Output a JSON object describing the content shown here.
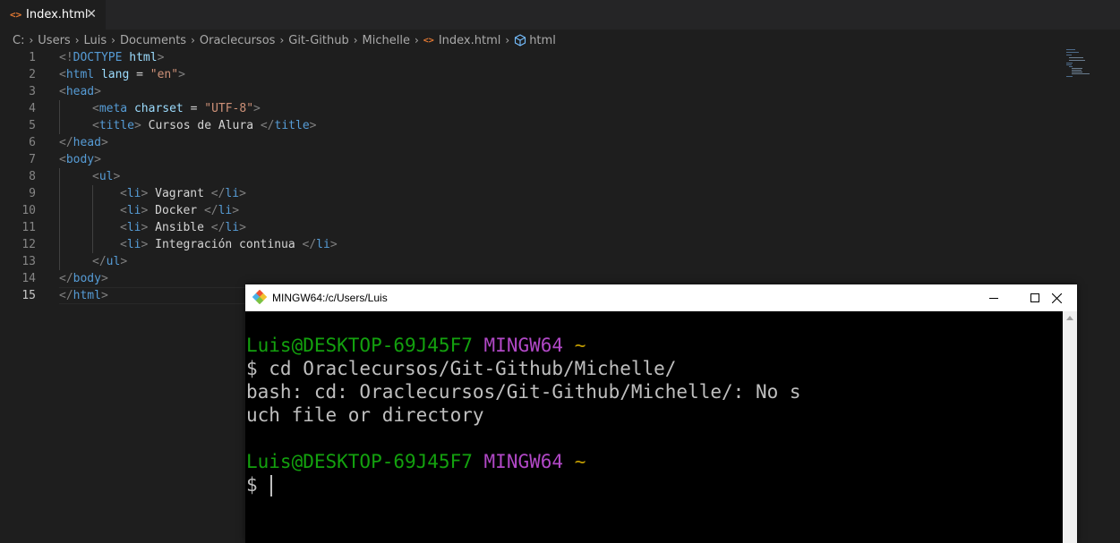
{
  "editor": {
    "tab": {
      "icon": "html-file-icon",
      "label": "Index.html",
      "close_glyph": "✕"
    },
    "breadcrumb": [
      "C:",
      "Users",
      "Luis",
      "Documents",
      "Oraclecursos",
      "Git-Github",
      "Michelle",
      "Index.html",
      "html"
    ],
    "active_line": 15,
    "lines": [
      {
        "n": "1",
        "indent": 0,
        "tokens": [
          [
            "p",
            "<!"
          ],
          [
            "tag",
            "DOCTYPE"
          ],
          [
            "txt",
            " "
          ],
          [
            "attr",
            "html"
          ],
          [
            "p",
            ">"
          ]
        ]
      },
      {
        "n": "2",
        "indent": 0,
        "tokens": [
          [
            "p",
            "<"
          ],
          [
            "tag",
            "html"
          ],
          [
            "txt",
            " "
          ],
          [
            "attr",
            "lang"
          ],
          [
            "txt",
            " = "
          ],
          [
            "str",
            "\"en\""
          ],
          [
            "p",
            ">"
          ]
        ]
      },
      {
        "n": "3",
        "indent": 0,
        "tokens": [
          [
            "p",
            "<"
          ],
          [
            "tag",
            "head"
          ],
          [
            "p",
            ">"
          ]
        ]
      },
      {
        "n": "4",
        "indent": 1,
        "tokens": [
          [
            "p",
            "<"
          ],
          [
            "tag",
            "meta"
          ],
          [
            "txt",
            " "
          ],
          [
            "attr",
            "charset"
          ],
          [
            "txt",
            " = "
          ],
          [
            "str",
            "\"UTF-8\""
          ],
          [
            "p",
            ">"
          ]
        ]
      },
      {
        "n": "5",
        "indent": 1,
        "tokens": [
          [
            "p",
            "<"
          ],
          [
            "tag",
            "title"
          ],
          [
            "p",
            ">"
          ],
          [
            "txt",
            " Cursos de Alura "
          ],
          [
            "p",
            "</"
          ],
          [
            "tag",
            "title"
          ],
          [
            "p",
            ">"
          ]
        ]
      },
      {
        "n": "6",
        "indent": 0,
        "tokens": [
          [
            "p",
            "</"
          ],
          [
            "tag",
            "head"
          ],
          [
            "p",
            ">"
          ]
        ]
      },
      {
        "n": "7",
        "indent": 0,
        "tokens": [
          [
            "p",
            "<"
          ],
          [
            "tag",
            "body"
          ],
          [
            "p",
            ">"
          ]
        ]
      },
      {
        "n": "8",
        "indent": 1,
        "tokens": [
          [
            "p",
            "<"
          ],
          [
            "tag",
            "ul"
          ],
          [
            "p",
            ">"
          ]
        ]
      },
      {
        "n": "9",
        "indent": 2,
        "tokens": [
          [
            "p",
            "<"
          ],
          [
            "tag",
            "li"
          ],
          [
            "p",
            ">"
          ],
          [
            "txt",
            " Vagrant "
          ],
          [
            "p",
            "</"
          ],
          [
            "tag",
            "li"
          ],
          [
            "p",
            ">"
          ]
        ]
      },
      {
        "n": "10",
        "indent": 2,
        "tokens": [
          [
            "p",
            "<"
          ],
          [
            "tag",
            "li"
          ],
          [
            "p",
            ">"
          ],
          [
            "txt",
            " Docker "
          ],
          [
            "p",
            "</"
          ],
          [
            "tag",
            "li"
          ],
          [
            "p",
            ">"
          ]
        ]
      },
      {
        "n": "11",
        "indent": 2,
        "tokens": [
          [
            "p",
            "<"
          ],
          [
            "tag",
            "li"
          ],
          [
            "p",
            ">"
          ],
          [
            "txt",
            " Ansible "
          ],
          [
            "p",
            "</"
          ],
          [
            "tag",
            "li"
          ],
          [
            "p",
            ">"
          ]
        ]
      },
      {
        "n": "12",
        "indent": 2,
        "tokens": [
          [
            "p",
            "<"
          ],
          [
            "tag",
            "li"
          ],
          [
            "p",
            ">"
          ],
          [
            "txt",
            " Integración continua "
          ],
          [
            "p",
            "</"
          ],
          [
            "tag",
            "li"
          ],
          [
            "p",
            ">"
          ]
        ]
      },
      {
        "n": "13",
        "indent": 1,
        "tokens": [
          [
            "p",
            "</"
          ],
          [
            "tag",
            "ul"
          ],
          [
            "p",
            ">"
          ]
        ]
      },
      {
        "n": "14",
        "indent": 0,
        "tokens": [
          [
            "p",
            "</"
          ],
          [
            "tag",
            "body"
          ],
          [
            "p",
            ">"
          ]
        ]
      },
      {
        "n": "15",
        "indent": 0,
        "tokens": [
          [
            "p",
            "</"
          ],
          [
            "tag",
            "html"
          ],
          [
            "p",
            ">"
          ]
        ]
      }
    ]
  },
  "terminal": {
    "title": "MINGW64:/c/Users/Luis",
    "buttons": {
      "minimize": "minimize-icon",
      "maximize": "maximize-icon",
      "close": "close-icon"
    },
    "prompt": {
      "user_host": "Luis@DESKTOP-69J45F7",
      "env": "MINGW64",
      "dir": "~"
    },
    "lines": [
      "$ cd Oraclecursos/Git-Github/Michelle/",
      "bash: cd: Oraclecursos/Git-Github/Michelle/: No s",
      "uch file or directory"
    ],
    "input_prompt": "$"
  },
  "colors": {
    "editor_bg": "#1e1e1e",
    "tag": "#569cd6",
    "attr": "#9cdcfe",
    "string": "#ce9178",
    "punct": "#808080",
    "term_green": "#13a10e",
    "term_purple": "#b148c6",
    "term_yellow": "#c19c00"
  }
}
